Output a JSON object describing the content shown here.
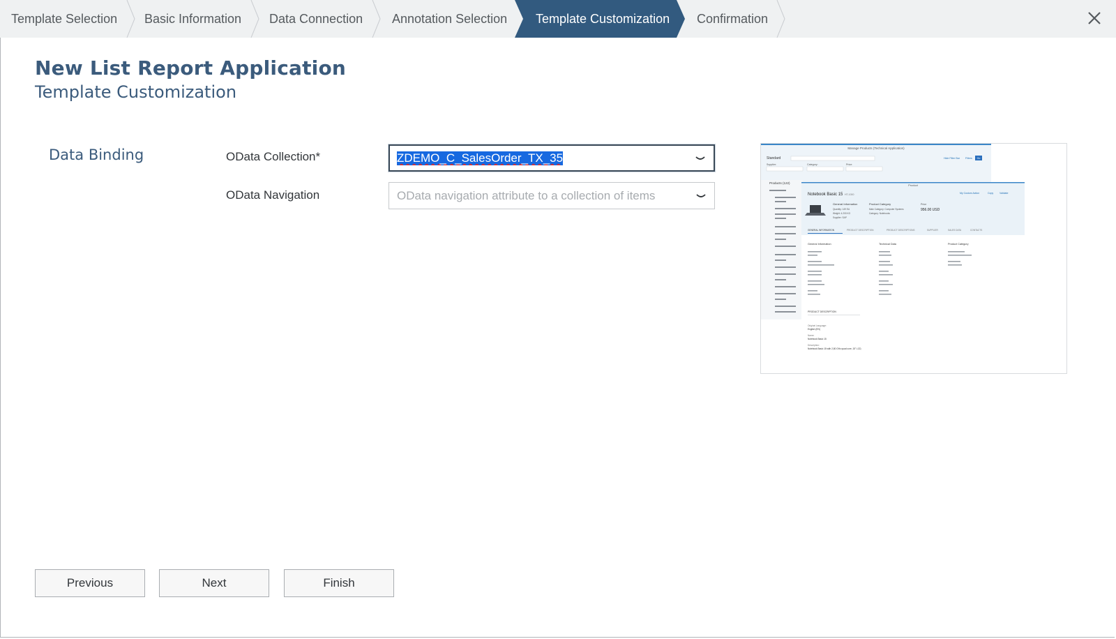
{
  "wizard": {
    "steps": [
      {
        "label": "Template Selection",
        "active": false
      },
      {
        "label": "Basic Information",
        "active": false
      },
      {
        "label": "Data Connection",
        "active": false
      },
      {
        "label": "Annotation Selection",
        "active": false
      },
      {
        "label": "Template Customization",
        "active": true
      },
      {
        "label": "Confirmation",
        "active": false
      }
    ],
    "close_icon": "close-icon"
  },
  "header": {
    "title": "New List Report Application",
    "subtitle": "Template Customization"
  },
  "form": {
    "section_label": "Data Binding",
    "odata_collection": {
      "label": "OData Collection*",
      "value": "ZDEMO_C_SalesOrder_TX_35"
    },
    "odata_navigation": {
      "label": "OData Navigation",
      "placeholder": "OData navigation attribute to a collection of items",
      "value": ""
    }
  },
  "preview": {
    "app_title": "Manage Products (Technical Application)",
    "variant": "Standard",
    "filter_supplier": "Supplier:",
    "filter_category": "Category:",
    "filter_price": "Price:",
    "hide_filter_bar": "Hide Filter Bar",
    "filters": "Filters",
    "go": "Go",
    "list_title": "Products (122)",
    "object_header_label": "Product",
    "product_name": "Notebook Basic 15",
    "product_id": "HT-1000",
    "actions": [
      "My Custom Action",
      "Copy",
      "Validate"
    ],
    "general_information": "General Information",
    "product_category": "Product Category",
    "price_label": "Price",
    "price": "956.00 USD",
    "quantity": "Quantity: 149 EA",
    "weight": "Weight: 4.200 KG",
    "supplier": "Supplier: SAP",
    "main_category": "Main Category: Computer Systems",
    "category": "Category: Notebooks",
    "tabs": [
      "GENERAL INFORMATION",
      "PRODUCT DESCRIPTION",
      "PRODUCT DESCRIPTIONS",
      "SUPPLIER",
      "SALES DATA",
      "CONTACTS"
    ],
    "col_general": "General Information",
    "col_technical": "Technical Data",
    "col_category": "Product Category",
    "section_product_description": "PRODUCT DESCRIPTION",
    "original_language": "Original Language:",
    "language_value": "English (EN)",
    "name_label": "Name:",
    "name_value": "Notebook Basic 15",
    "description_label": "Description:",
    "description_value": "Notebook Basic 15 with 2,80 GHz quad core, 15\" LCD,"
  },
  "buttons": {
    "previous": "Previous",
    "next": "Next",
    "finish": "Finish"
  },
  "colors": {
    "accent": "#325a7f",
    "title": "#3b5b7c",
    "selection": "#1769e0",
    "stepbar_bg": "#eff1f2"
  }
}
